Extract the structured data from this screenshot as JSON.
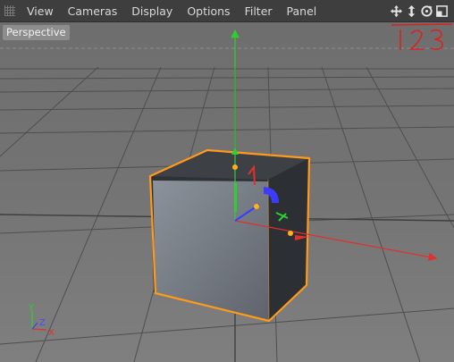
{
  "menubar": {
    "items": [
      {
        "label": "View"
      },
      {
        "label": "Cameras"
      },
      {
        "label": "Display"
      },
      {
        "label": "Options"
      },
      {
        "label": "Filter"
      },
      {
        "label": "Panel"
      }
    ],
    "nav_icons": [
      "move-view-icon",
      "dolly-view-icon",
      "rotate-view-icon",
      "toggle-view-icon"
    ]
  },
  "viewport": {
    "camera_label": "Perspective",
    "annotation": "123",
    "axis_gizmo": {
      "x": "X",
      "y": "Y",
      "z": "Z"
    },
    "colors": {
      "x_axis": "#e03030",
      "y_axis": "#2fcf2f",
      "z_axis": "#3c3cff",
      "selection": "#ff9a1a",
      "annotation": "#d92222"
    }
  }
}
